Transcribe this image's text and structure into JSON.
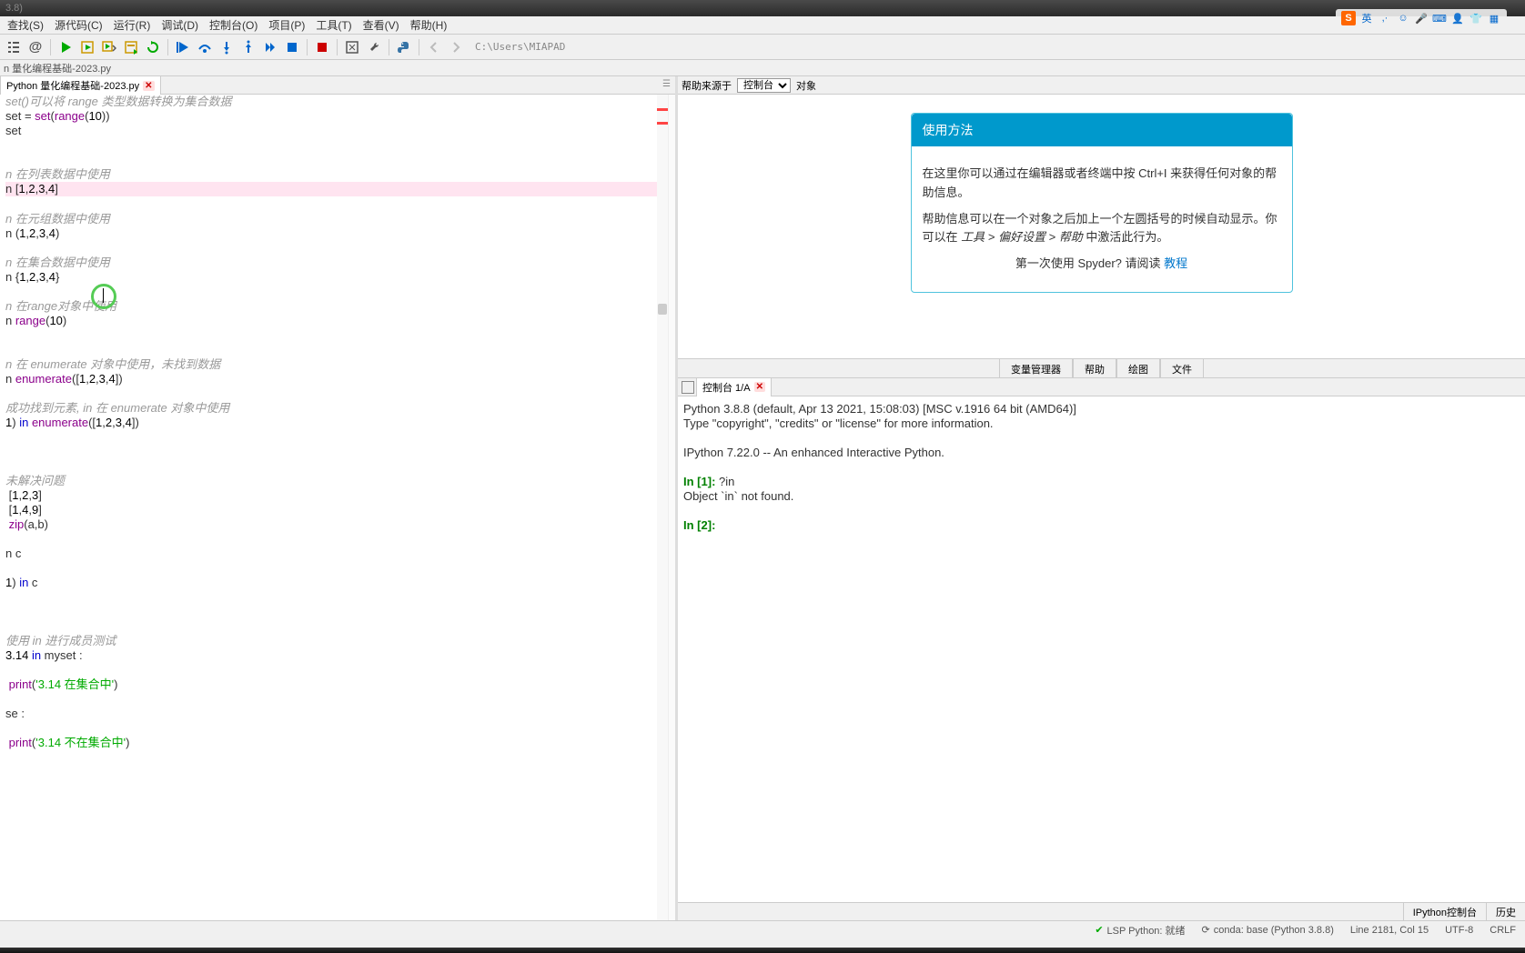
{
  "title_version": "3.8)",
  "menu": [
    "查找(S)",
    "源代码(C)",
    "运行(R)",
    "调试(D)",
    "控制台(O)",
    "项目(P)",
    "工具(T)",
    "查看(V)",
    "帮助(H)"
  ],
  "path": "C:\\Users\\MIAPAD",
  "breadcrumb": "n 量化编程基础-2023.py",
  "file_tab": "Python 量化编程基础-2023.py",
  "code_lines": [
    {
      "t": "comment",
      "text": "set()可以将 range 类型数据转换为集合数据"
    },
    {
      "t": "code",
      "text": "set = set(range(10))",
      "parts": [
        {
          "c": "",
          "t": "set = "
        },
        {
          "c": "builtin",
          "t": "set"
        },
        {
          "c": "",
          "t": "("
        },
        {
          "c": "builtin",
          "t": "range"
        },
        {
          "c": "",
          "t": "("
        },
        {
          "c": "number",
          "t": "10"
        },
        {
          "c": "",
          "t": "))"
        }
      ]
    },
    {
      "t": "code",
      "text": "set"
    },
    {
      "t": "blank"
    },
    {
      "t": "blank"
    },
    {
      "t": "comment",
      "text": "n 在列表数据中使用"
    },
    {
      "t": "highlight",
      "text": "n [1,2,3,4]",
      "parts": [
        {
          "c": "",
          "t": "n ["
        },
        {
          "c": "number",
          "t": "1"
        },
        {
          "c": "",
          "t": ","
        },
        {
          "c": "number",
          "t": "2"
        },
        {
          "c": "",
          "t": ","
        },
        {
          "c": "number",
          "t": "3"
        },
        {
          "c": "",
          "t": ","
        },
        {
          "c": "number",
          "t": "4"
        },
        {
          "c": "",
          "t": "]"
        }
      ]
    },
    {
      "t": "blank"
    },
    {
      "t": "comment",
      "text": "n 在元组数据中使用"
    },
    {
      "t": "code",
      "text": "n (1,2,3,4)",
      "parts": [
        {
          "c": "",
          "t": "n ("
        },
        {
          "c": "number",
          "t": "1"
        },
        {
          "c": "",
          "t": ","
        },
        {
          "c": "number",
          "t": "2"
        },
        {
          "c": "",
          "t": ","
        },
        {
          "c": "number",
          "t": "3"
        },
        {
          "c": "",
          "t": ","
        },
        {
          "c": "number",
          "t": "4"
        },
        {
          "c": "",
          "t": ")"
        }
      ]
    },
    {
      "t": "blank"
    },
    {
      "t": "comment",
      "text": "n 在集合数据中使用"
    },
    {
      "t": "code",
      "text": "n {1,2,3,4}",
      "parts": [
        {
          "c": "",
          "t": "n {"
        },
        {
          "c": "number",
          "t": "1"
        },
        {
          "c": "",
          "t": ","
        },
        {
          "c": "number",
          "t": "2"
        },
        {
          "c": "",
          "t": ","
        },
        {
          "c": "number",
          "t": "3"
        },
        {
          "c": "",
          "t": ","
        },
        {
          "c": "number",
          "t": "4"
        },
        {
          "c": "",
          "t": "}"
        }
      ]
    },
    {
      "t": "blank"
    },
    {
      "t": "comment",
      "text": "n 在range对象中使用"
    },
    {
      "t": "code",
      "text": "n range(10)",
      "parts": [
        {
          "c": "",
          "t": "n "
        },
        {
          "c": "builtin",
          "t": "range"
        },
        {
          "c": "",
          "t": "("
        },
        {
          "c": "number",
          "t": "10"
        },
        {
          "c": "",
          "t": ")"
        }
      ]
    },
    {
      "t": "blank"
    },
    {
      "t": "blank"
    },
    {
      "t": "comment",
      "text": "n 在 enumerate 对象中使用，未找到数据"
    },
    {
      "t": "code",
      "text": "n enumerate([1,2,3,4])",
      "parts": [
        {
          "c": "",
          "t": "n "
        },
        {
          "c": "builtin",
          "t": "enumerate"
        },
        {
          "c": "",
          "t": "(["
        },
        {
          "c": "number",
          "t": "1"
        },
        {
          "c": "",
          "t": ","
        },
        {
          "c": "number",
          "t": "2"
        },
        {
          "c": "",
          "t": ","
        },
        {
          "c": "number",
          "t": "3"
        },
        {
          "c": "",
          "t": ","
        },
        {
          "c": "number",
          "t": "4"
        },
        {
          "c": "",
          "t": "])"
        }
      ]
    },
    {
      "t": "blank"
    },
    {
      "t": "comment",
      "text": "成功找到元素, in 在 enumerate 对象中使用"
    },
    {
      "t": "code",
      "text": "1) in enumerate([1,2,3,4])",
      "parts": [
        {
          "c": "number",
          "t": "1"
        },
        {
          "c": "",
          "t": ") "
        },
        {
          "c": "keyword",
          "t": "in"
        },
        {
          "c": "",
          "t": " "
        },
        {
          "c": "builtin",
          "t": "enumerate"
        },
        {
          "c": "",
          "t": "(["
        },
        {
          "c": "number",
          "t": "1"
        },
        {
          "c": "",
          "t": ","
        },
        {
          "c": "number",
          "t": "2"
        },
        {
          "c": "",
          "t": ","
        },
        {
          "c": "number",
          "t": "3"
        },
        {
          "c": "",
          "t": ","
        },
        {
          "c": "number",
          "t": "4"
        },
        {
          "c": "",
          "t": "])"
        }
      ]
    },
    {
      "t": "blank"
    },
    {
      "t": "blank"
    },
    {
      "t": "blank"
    },
    {
      "t": "comment",
      "text": "未解决问题"
    },
    {
      "t": "code",
      "text": " [1,2,3]",
      "parts": [
        {
          "c": "",
          "t": " ["
        },
        {
          "c": "number",
          "t": "1"
        },
        {
          "c": "",
          "t": ","
        },
        {
          "c": "number",
          "t": "2"
        },
        {
          "c": "",
          "t": ","
        },
        {
          "c": "number",
          "t": "3"
        },
        {
          "c": "",
          "t": "]"
        }
      ]
    },
    {
      "t": "code",
      "text": " [1,4,9]",
      "parts": [
        {
          "c": "",
          "t": " ["
        },
        {
          "c": "number",
          "t": "1"
        },
        {
          "c": "",
          "t": ","
        },
        {
          "c": "number",
          "t": "4"
        },
        {
          "c": "",
          "t": ","
        },
        {
          "c": "number",
          "t": "9"
        },
        {
          "c": "",
          "t": "]"
        }
      ]
    },
    {
      "t": "code",
      "text": " zip(a,b)",
      "parts": [
        {
          "c": "",
          "t": " "
        },
        {
          "c": "builtin",
          "t": "zip"
        },
        {
          "c": "",
          "t": "(a,b)"
        }
      ]
    },
    {
      "t": "blank"
    },
    {
      "t": "code",
      "text": "n c"
    },
    {
      "t": "blank"
    },
    {
      "t": "code",
      "text": "1) in c",
      "parts": [
        {
          "c": "number",
          "t": "1"
        },
        {
          "c": "",
          "t": ") "
        },
        {
          "c": "keyword",
          "t": "in"
        },
        {
          "c": "",
          "t": " c"
        }
      ]
    },
    {
      "t": "blank"
    },
    {
      "t": "blank"
    },
    {
      "t": "blank"
    },
    {
      "t": "comment",
      "text": "使用 in 进行成员测试"
    },
    {
      "t": "code",
      "text": "3.14 in myset :",
      "parts": [
        {
          "c": "number",
          "t": "3.14"
        },
        {
          "c": "",
          "t": " "
        },
        {
          "c": "keyword",
          "t": "in"
        },
        {
          "c": "",
          "t": " myset :"
        }
      ]
    },
    {
      "t": "blank"
    },
    {
      "t": "code",
      "text": " print('3.14 在集合中')",
      "parts": [
        {
          "c": "",
          "t": " "
        },
        {
          "c": "builtin",
          "t": "print"
        },
        {
          "c": "",
          "t": "("
        },
        {
          "c": "string",
          "t": "'3.14 在集合中'"
        },
        {
          "c": "",
          "t": ")"
        }
      ]
    },
    {
      "t": "blank"
    },
    {
      "t": "code",
      "text": "se :"
    },
    {
      "t": "blank"
    },
    {
      "t": "code",
      "text": " print('3.14 不在集合中')",
      "parts": [
        {
          "c": "",
          "t": " "
        },
        {
          "c": "builtin",
          "t": "print"
        },
        {
          "c": "",
          "t": "("
        },
        {
          "c": "string",
          "t": "'3.14 不在集合中'"
        },
        {
          "c": "",
          "t": ")"
        }
      ]
    }
  ],
  "help": {
    "source_label": "帮助来源于",
    "source_value": "控制台",
    "object_label": "对象",
    "title": "使用方法",
    "p1": "在这里你可以通过在编辑器或者终端中按 Ctrl+I 来获得任何对象的帮助信息。",
    "p2_a": "帮助信息可以在一个对象之后加上一个左圆括号的时候自动显示。你可以在 ",
    "p2_b": "工具 > 偏好设置 > 帮助",
    "p2_c": " 中激活此行为。",
    "p3_a": "第一次使用 Spyder? 请阅读 ",
    "p3_link": "教程"
  },
  "help_tabs": [
    "变量管理器",
    "帮助",
    "绘图",
    "文件"
  ],
  "console": {
    "tab": "控制台 1/A",
    "lines": [
      "Python 3.8.8 (default, Apr 13 2021, 15:08:03) [MSC v.1916 64 bit (AMD64)]",
      "Type \"copyright\", \"credits\" or \"license\" for more information.",
      "",
      "IPython 7.22.0 -- An enhanced Interactive Python.",
      "",
      "In [1]: ?in",
      "Object `in` not found.",
      "",
      "In [2]: "
    ],
    "bottom_tabs": [
      "IPython控制台",
      "历史"
    ]
  },
  "status": {
    "lsp": "LSP Python: 就绪",
    "conda": "conda: base (Python 3.8.8)",
    "pos": "Line 2181, Col 15",
    "enc": "UTF-8",
    "eol": "CRLF"
  },
  "ime": {
    "lang": "英"
  }
}
